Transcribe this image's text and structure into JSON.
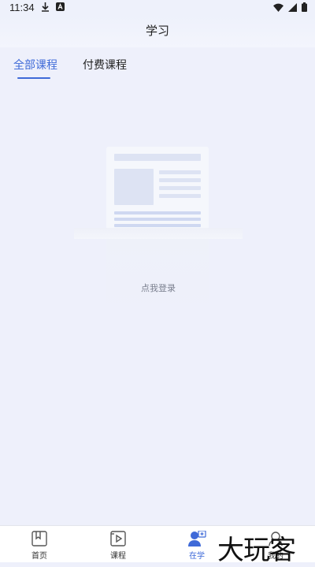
{
  "status_bar": {
    "time": "11:34"
  },
  "header": {
    "title": "学习"
  },
  "tabs": [
    {
      "label": "全部课程",
      "active": true
    },
    {
      "label": "付费课程",
      "active": false
    }
  ],
  "empty_state": {
    "login_label": "点我登录"
  },
  "bottom_nav": {
    "items": [
      {
        "label": "首页",
        "icon": "book-icon"
      },
      {
        "label": "课程",
        "icon": "video-icon"
      },
      {
        "label": "在学",
        "icon": "user-icon",
        "active": true
      },
      {
        "label": "我的",
        "icon": "profile-icon"
      }
    ]
  },
  "watermark": "大玩客",
  "colors": {
    "accent": "#3f6ad8",
    "background": "#eef0fb"
  }
}
